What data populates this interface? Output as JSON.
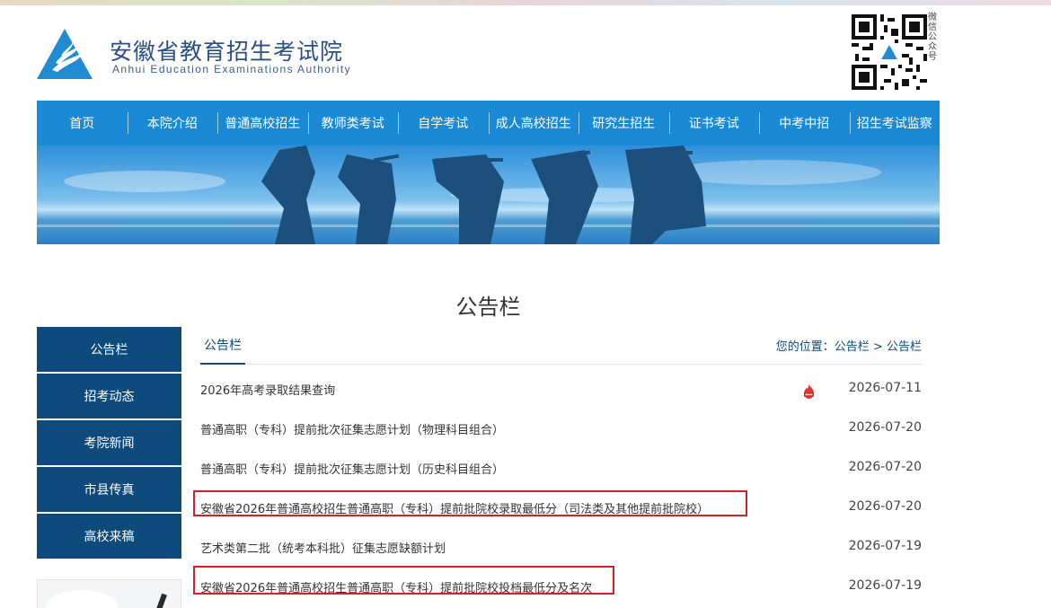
{
  "header": {
    "site_title": "安徽省教育招生考试院",
    "site_subtitle": "Anhui Education Examinations Authority",
    "qr_label": "微信公众号"
  },
  "nav": [
    "首页",
    "本院介绍",
    "普通高校招生",
    "教师类考试",
    "自学考试",
    "成人高校招生",
    "研究生招生",
    "证书考试",
    "中考中招",
    "招生考试监察"
  ],
  "page_title": "公告栏",
  "sidebar": [
    "公告栏",
    "招考动态",
    "考院新闻",
    "市县传真",
    "高校来稿"
  ],
  "content": {
    "tab": "公告栏",
    "breadcrumb": {
      "prefix": "您的位置：",
      "level1": "公告栏",
      "sep": " > ",
      "level2": "公告栏"
    },
    "items": [
      {
        "title": "2026年高考录取结果查询",
        "date": "2026-07-11",
        "hot": true,
        "highlighted": false
      },
      {
        "title": "普通高职（专科）提前批次征集志愿计划（物理科目组合）",
        "date": "2026-07-20",
        "hot": false,
        "highlighted": false
      },
      {
        "title": "普通高职（专科）提前批次征集志愿计划（历史科目组合）",
        "date": "2026-07-20",
        "hot": false,
        "highlighted": false
      },
      {
        "title": "安徽省2026年普通高校招生普通高职（专科）提前批院校录取最低分（司法类及其他提前批院校）",
        "date": "2026-07-20",
        "hot": false,
        "highlighted": true
      },
      {
        "title": "艺术类第二批（统考本科批）征集志愿缺额计划",
        "date": "2026-07-19",
        "hot": false,
        "highlighted": false
      },
      {
        "title": "安徽省2026年普通高校招生普通高职（专科）提前批院校投档最低分及名次",
        "date": "2026-07-19",
        "hot": false,
        "highlighted": true
      }
    ]
  },
  "colors": {
    "nav_bg": "#1a8ad6",
    "sidebar_bg": "#0f4a7c",
    "highlight_border": "#d61f26",
    "title_blue": "#2a4e85"
  },
  "icons": {
    "logo": "triangle-flame-logo-icon",
    "qr": "qr-code-icon",
    "hot": "hot-flame-icon"
  }
}
